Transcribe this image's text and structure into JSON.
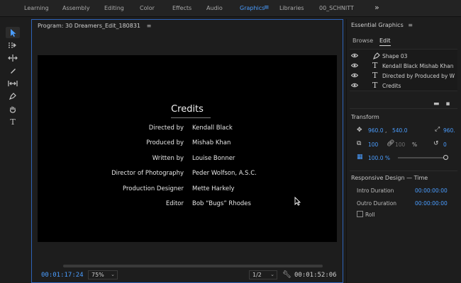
{
  "workspace": {
    "tabs": [
      {
        "label": "Learning"
      },
      {
        "label": "Assembly"
      },
      {
        "label": "Editing"
      },
      {
        "label": "Color"
      },
      {
        "label": "Effects"
      },
      {
        "label": "Audio"
      },
      {
        "label": "Graphics",
        "active": true
      },
      {
        "label": "Libraries"
      },
      {
        "label": "00_SCHNITT"
      }
    ],
    "more": "»",
    "menu": "≡"
  },
  "program": {
    "title": "Program: 30 Dreamers_Edit_180831",
    "menu": "≡",
    "credits": {
      "title": "Credits",
      "rows": [
        {
          "role": "Directed by",
          "person": "Kendall Black"
        },
        {
          "role": "Produced by",
          "person": "Mishab Khan"
        },
        {
          "role": "Written by",
          "person": "Louise Bonner"
        },
        {
          "role": "Director of Photography",
          "person": "Peder Wolfson, A.S.C."
        },
        {
          "role": "Production Designer",
          "person": "Mette Harkely"
        },
        {
          "role": "Editor",
          "person": "Bob “Bugs” Rhodes"
        }
      ]
    },
    "timecode_current": "00:01:17:24",
    "zoom": "75%",
    "resolution": "1/2",
    "timecode_duration": "00:01:52:06"
  },
  "essential_graphics": {
    "title": "Essential Graphics",
    "menu": "≡",
    "tabs": [
      {
        "label": "Browse"
      },
      {
        "label": "Edit",
        "active": true
      }
    ],
    "layers": [
      {
        "kind": "shape",
        "name": "Shape 03"
      },
      {
        "kind": "text",
        "name": "Kendall Black Mishab Khan L..."
      },
      {
        "kind": "text",
        "name": "Directed by Produced by Writ..."
      },
      {
        "kind": "text",
        "name": "Credits"
      }
    ],
    "transform": {
      "title": "Transform",
      "position_x": "960.0",
      "position_sep": ",",
      "position_y": "540.0",
      "anchor_x": "960.",
      "scale_w": "100",
      "scale_h": "100",
      "scale_unit": "%",
      "rotation": "0",
      "opacity": "100.0 %"
    },
    "responsive": {
      "title": "Responsive Design — Time",
      "intro_label": "Intro Duration",
      "intro_value": "00:00:00:00",
      "outro_label": "Outro Duration",
      "outro_value": "00:00:00:00",
      "roll_label": "Roll"
    }
  }
}
